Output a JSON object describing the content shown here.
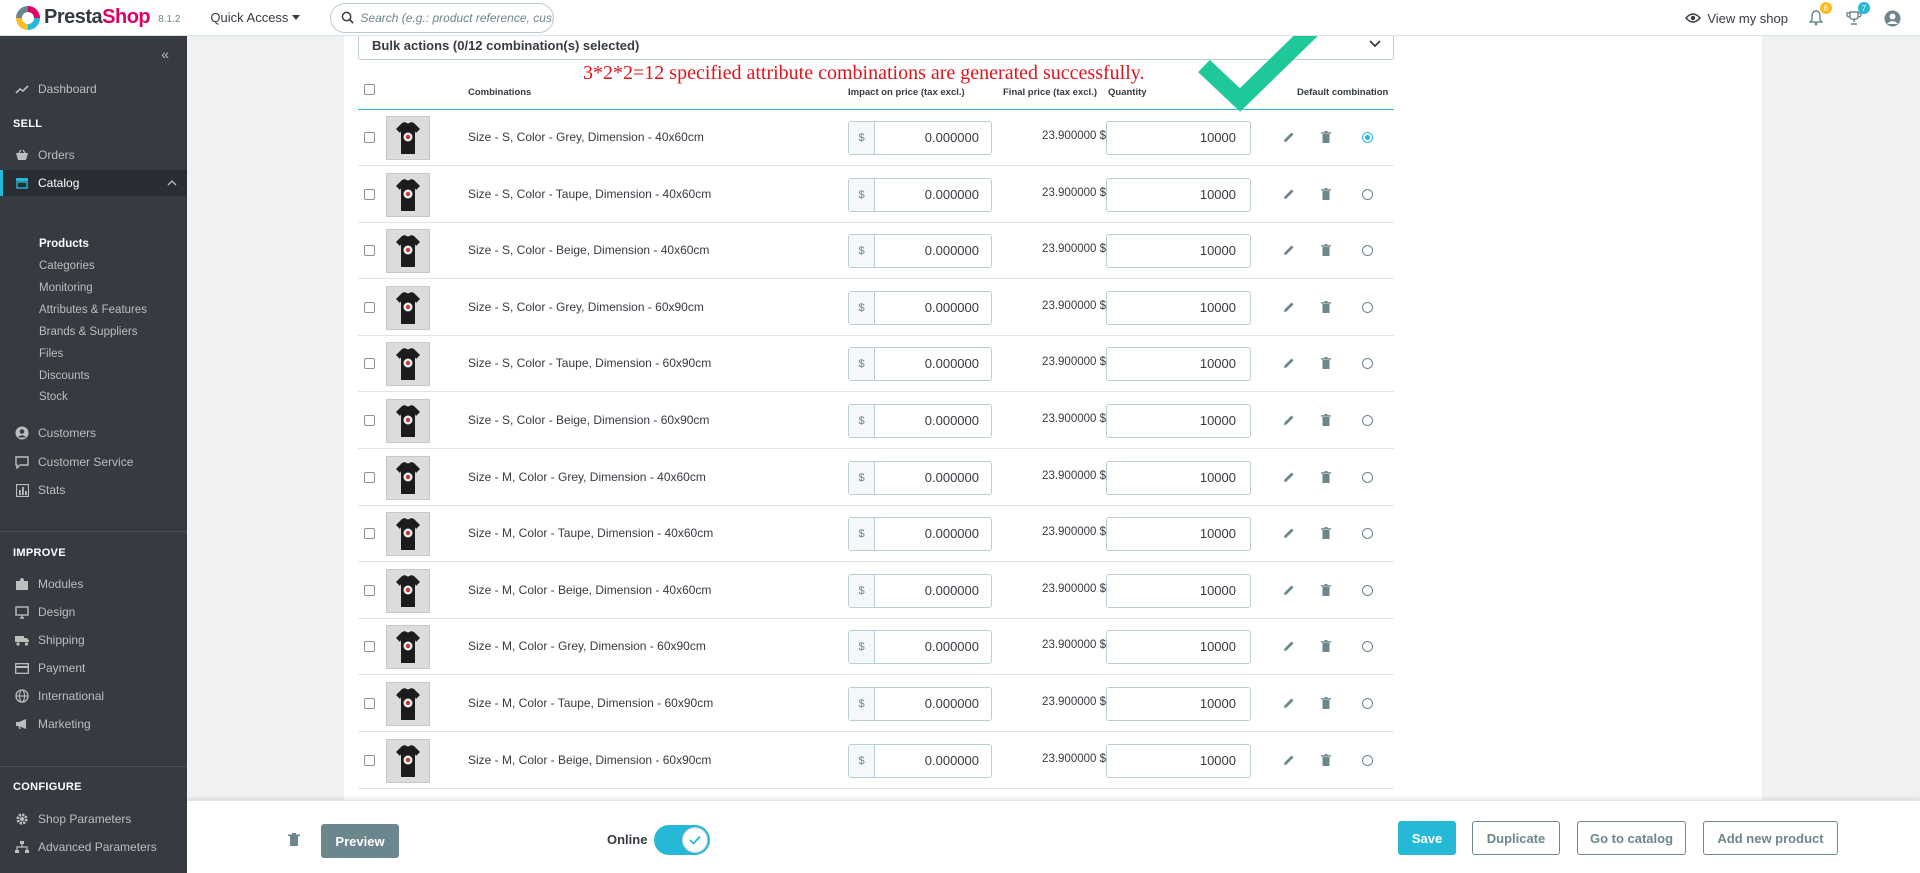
{
  "header": {
    "brand_prefix": "Presta",
    "brand_suffix": "Shop",
    "version": "8.1.2",
    "quick_access": "Quick Access",
    "search_placeholder": "Search (e.g.: product reference, custon",
    "view_shop": "View my shop",
    "notifications_count": "6",
    "orders_count": "7"
  },
  "sidebar": {
    "dashboard": "Dashboard",
    "sell_title": "SELL",
    "orders": "Orders",
    "catalog": "Catalog",
    "catalog_sub": [
      "Products",
      "Categories",
      "Monitoring",
      "Attributes & Features",
      "Brands & Suppliers",
      "Files",
      "Discounts",
      "Stock"
    ],
    "customers": "Customers",
    "customer_service": "Customer Service",
    "stats": "Stats",
    "improve_title": "IMPROVE",
    "modules": "Modules",
    "design": "Design",
    "shipping": "Shipping",
    "payment": "Payment",
    "international": "International",
    "marketing": "Marketing",
    "configure_title": "CONFIGURE",
    "shop_parameters": "Shop Parameters",
    "advanced_parameters": "Advanced Parameters"
  },
  "bulk_actions": "Bulk actions (0/12 combination(s) selected)",
  "annotation": "3*2*2=12 specified attribute combinations are generated successfully.",
  "table": {
    "headers": {
      "combinations": "Combinations",
      "impact": "Impact on price (tax excl.)",
      "final": "Final price (tax excl.)",
      "quantity": "Quantity",
      "default": "Default combination"
    },
    "currency": "$",
    "rows": [
      {
        "name": "Size - S, Color - Grey, Dimension - 40x60cm",
        "impact": "0.000000",
        "final": "23.900000 $",
        "qty": "10000"
      },
      {
        "name": "Size - S, Color - Taupe, Dimension - 40x60cm",
        "impact": "0.000000",
        "final": "23.900000 $",
        "qty": "10000"
      },
      {
        "name": "Size - S, Color - Beige, Dimension - 40x60cm",
        "impact": "0.000000",
        "final": "23.900000 $",
        "qty": "10000"
      },
      {
        "name": "Size - S, Color - Grey, Dimension - 60x90cm",
        "impact": "0.000000",
        "final": "23.900000 $",
        "qty": "10000"
      },
      {
        "name": "Size - S, Color - Taupe, Dimension - 60x90cm",
        "impact": "0.000000",
        "final": "23.900000 $",
        "qty": "10000"
      },
      {
        "name": "Size - S, Color - Beige, Dimension - 60x90cm",
        "impact": "0.000000",
        "final": "23.900000 $",
        "qty": "10000"
      },
      {
        "name": "Size - M, Color - Grey, Dimension - 40x60cm",
        "impact": "0.000000",
        "final": "23.900000 $",
        "qty": "10000"
      },
      {
        "name": "Size - M, Color - Taupe, Dimension - 40x60cm",
        "impact": "0.000000",
        "final": "23.900000 $",
        "qty": "10000"
      },
      {
        "name": "Size - M, Color - Beige, Dimension - 40x60cm",
        "impact": "0.000000",
        "final": "23.900000 $",
        "qty": "10000"
      },
      {
        "name": "Size - M, Color - Grey, Dimension - 60x90cm",
        "impact": "0.000000",
        "final": "23.900000 $",
        "qty": "10000"
      },
      {
        "name": "Size - M, Color - Taupe, Dimension - 60x90cm",
        "impact": "0.000000",
        "final": "23.900000 $",
        "qty": "10000"
      },
      {
        "name": "Size - M, Color - Beige, Dimension - 60x90cm",
        "impact": "0.000000",
        "final": "23.900000 $",
        "qty": "10000"
      }
    ],
    "default_selected_index": 0
  },
  "footer": {
    "preview": "Preview",
    "online": "Online",
    "save": "Save",
    "duplicate": "Duplicate",
    "go_to_catalog": "Go to catalog",
    "add_new_product": "Add new product"
  },
  "colors": {
    "primary": "#25b9d7",
    "sidebar_bg": "#363a41",
    "annotation": "#e0141a",
    "checkmark": "#1fc89a"
  }
}
